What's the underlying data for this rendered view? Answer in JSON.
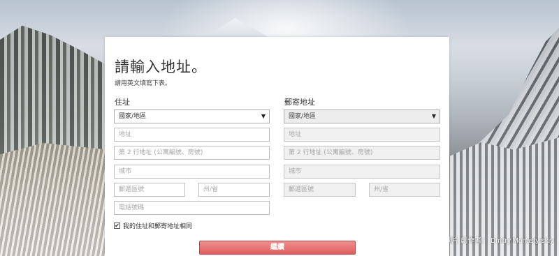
{
  "title": "請輸入地址。",
  "subtitle": "請用英文填寫下表。",
  "residential": {
    "label": "住址",
    "country": "國家/地區",
    "address1_placeholder": "地址",
    "address2_placeholder": "第 2 行地址 (公寓編號、房號)",
    "city_placeholder": "城市",
    "postal_placeholder": "郵遞區號",
    "state_placeholder": "州/省",
    "phone_placeholder": "電話號碼"
  },
  "mailing": {
    "label": "郵寄地址",
    "country": "國家/地區",
    "address1_placeholder": "地址",
    "address2_placeholder": "第 2 行地址 (公寓編號、房號)",
    "city_placeholder": "城市",
    "postal_placeholder": "郵遞區號",
    "state_placeholder": "州/省"
  },
  "same_address_label": "我的住址和郵寄地址相同",
  "same_address_checked": true,
  "checkbox_mark": "✔",
  "continue_label": "繼續",
  "caret": "▼",
  "photo_credit": "圖片 創作者： Dmitry Monastyrskiy",
  "colors": {
    "button": "#de5f5f",
    "panel": "#ffffff"
  }
}
